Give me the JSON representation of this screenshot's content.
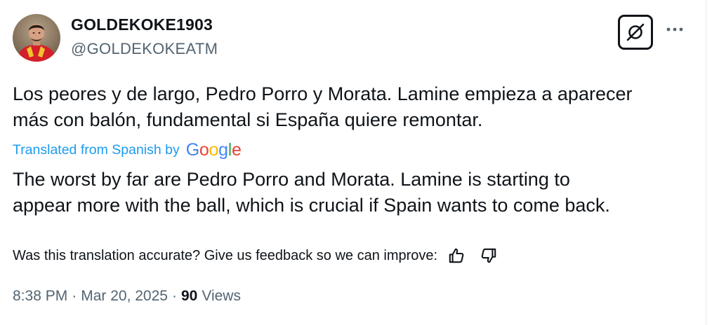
{
  "author": {
    "display_name": "GOLDEKOKE1903",
    "handle": "@GOLDEKOKEATM"
  },
  "tweet": {
    "text": "Los peores y de largo, Pedro Porro y Morata. Lamine empieza a aparecer\nmás con balón, fundamental si España quiere remontar.",
    "translated_label": "Translated from Spanish by",
    "translation_provider": [
      "G",
      "o",
      "o",
      "g",
      "l",
      "e"
    ],
    "translation": "The worst by far are Pedro Porro and Morata. Lamine is starting to\nappear more with the ball, which is crucial if Spain wants to come back."
  },
  "feedback": {
    "prompt": "Was this translation accurate? Give us feedback so we can improve:"
  },
  "meta": {
    "time": "8:38 PM",
    "separator": "·",
    "date": "Mar 20, 2025",
    "views_count": "90",
    "views_label": "Views"
  },
  "icons": {
    "grok": "grok-icon",
    "more": "more-horizontal-icon",
    "thumbs_up": "thumbs-up-icon",
    "thumbs_down": "thumbs-down-icon"
  },
  "colors": {
    "text": "#0f1419",
    "secondary": "#536471",
    "link": "#1d9bf0",
    "google_blue": "#4285f4",
    "google_red": "#ea4335",
    "google_yellow": "#fbbc05",
    "google_green": "#34a853"
  }
}
